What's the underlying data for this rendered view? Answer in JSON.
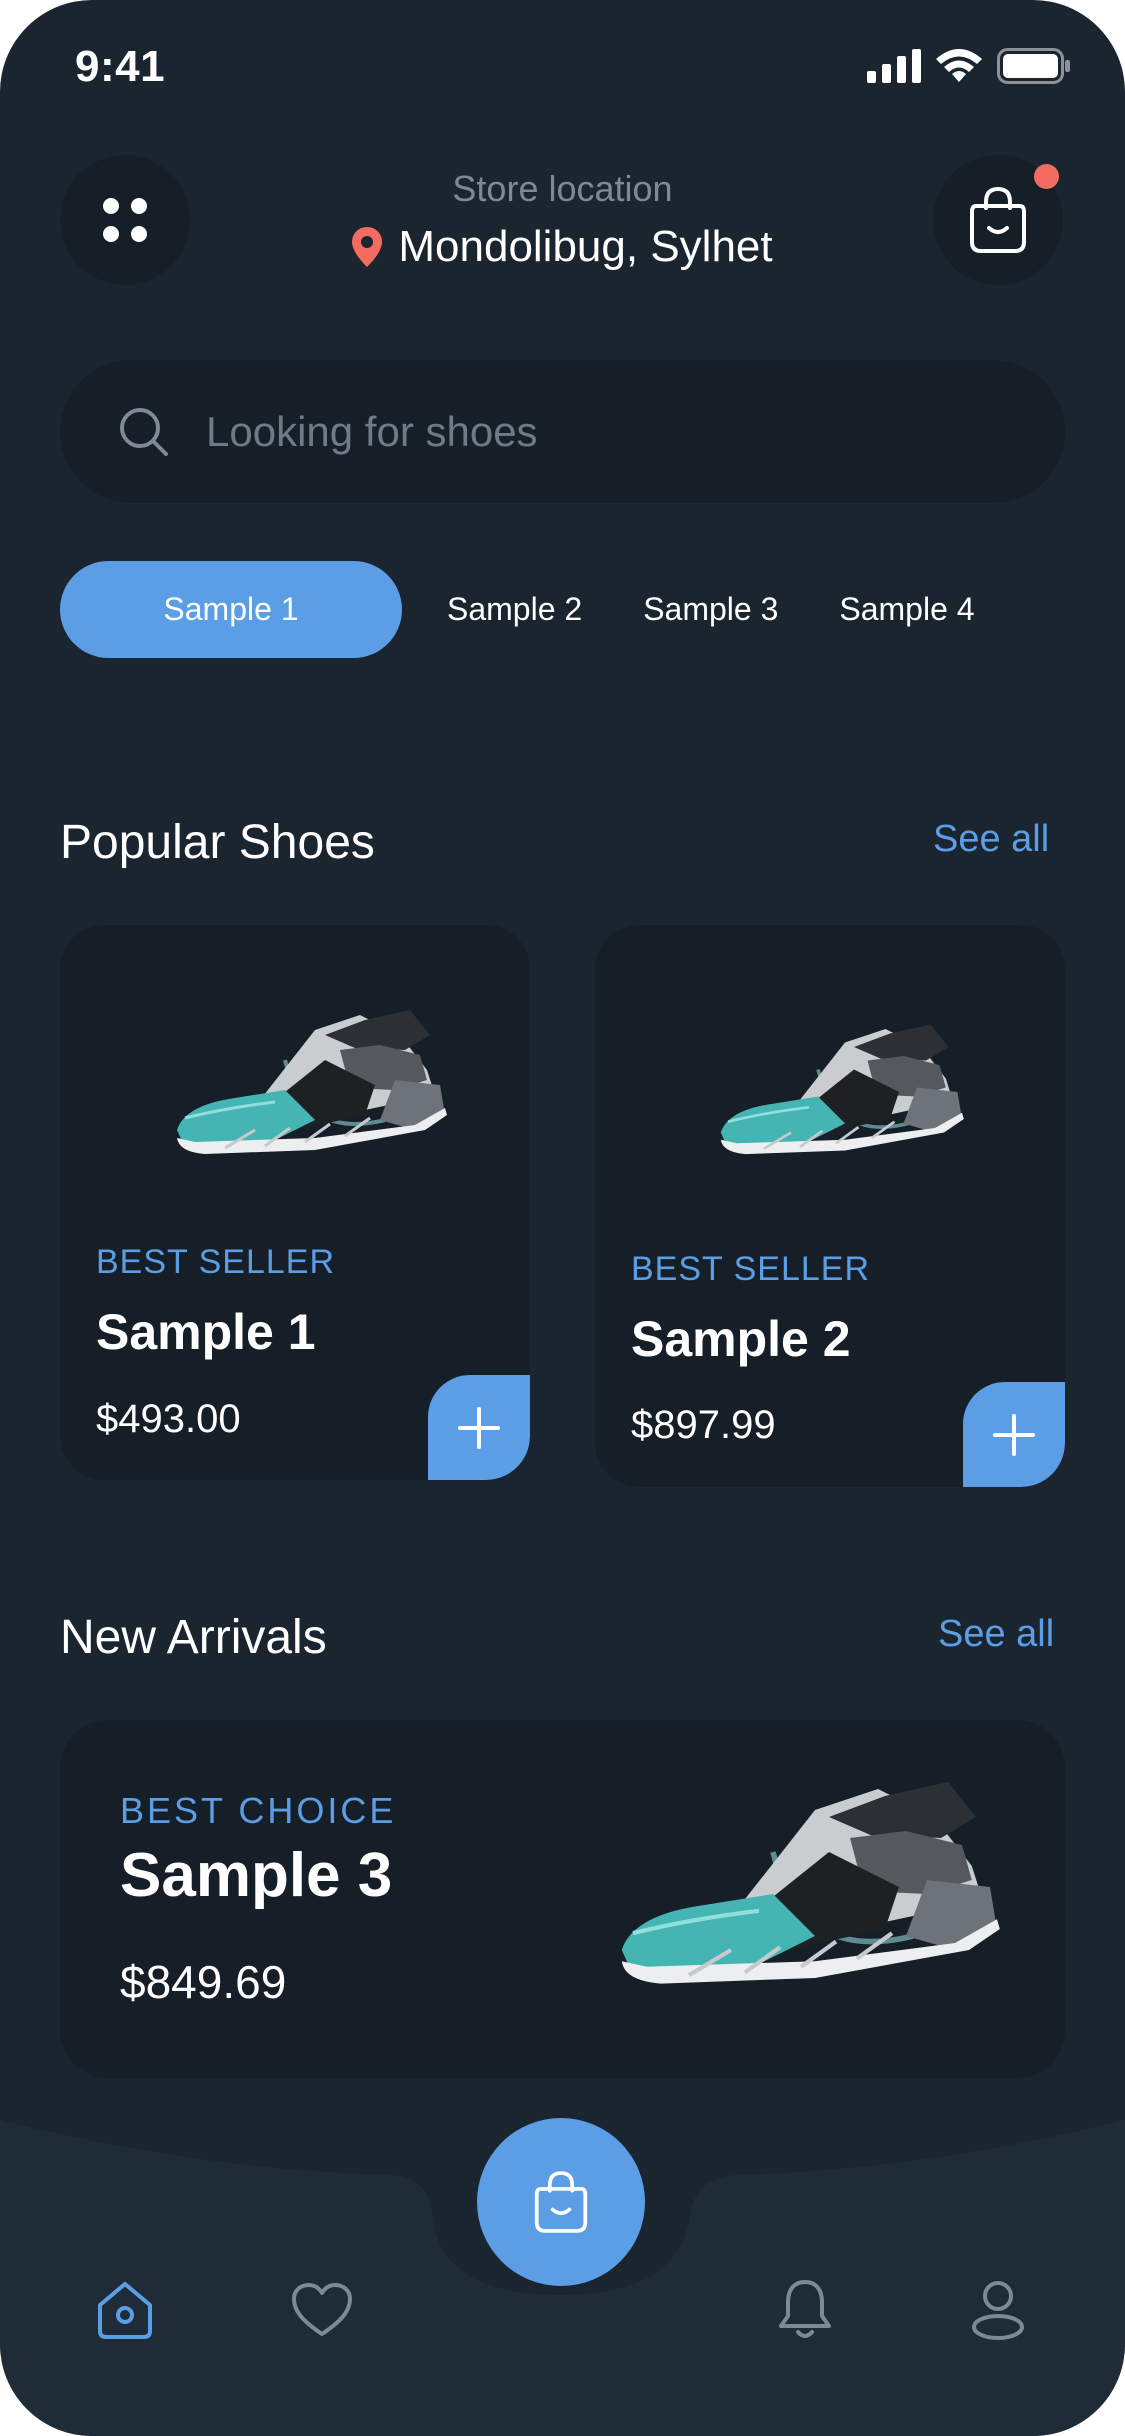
{
  "status_bar": {
    "time": "9:41"
  },
  "header": {
    "store_caption": "Store location",
    "store_name": "Mondolibug, Sylhet",
    "cart_has_notification": true
  },
  "search": {
    "placeholder": "Looking for shoes",
    "value": ""
  },
  "categories": [
    {
      "label": "Sample 1",
      "active": true
    },
    {
      "label": "Sample 2",
      "active": false
    },
    {
      "label": "Sample 3",
      "active": false
    },
    {
      "label": "Sample 4",
      "active": false
    }
  ],
  "popular": {
    "title": "Popular Shoes",
    "see_all": "See all",
    "items": [
      {
        "badge": "BEST SELLER",
        "name": "Sample 1",
        "price": "$493.00"
      },
      {
        "badge": "BEST SELLER",
        "name": "Sample 2",
        "price": "$897.99"
      }
    ]
  },
  "new_arrivals": {
    "title": "New Arrivals",
    "see_all": "See all",
    "item": {
      "badge": "BEST CHOICE",
      "name": "Sample 3",
      "price": "$849.69"
    }
  },
  "nav": {
    "items": [
      {
        "icon": "home-icon",
        "active": true
      },
      {
        "icon": "heart-icon",
        "active": false
      },
      {
        "icon": "bell-icon",
        "active": false
      },
      {
        "icon": "profile-icon",
        "active": false
      }
    ],
    "center_icon": "shopping-bag-icon"
  },
  "colors": {
    "background": "#1a2530",
    "surface": "#161f28",
    "accent": "#5c9ee5",
    "notification": "#f26c5f",
    "muted_text": "#7d8994"
  }
}
